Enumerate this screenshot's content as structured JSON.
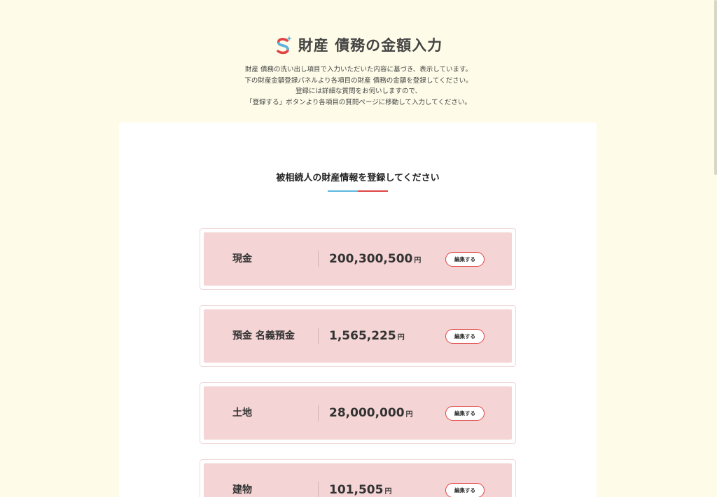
{
  "header": {
    "title": "財産 債務の金額入力",
    "logo_icon": "s-logo-icon",
    "intro_lines": [
      "財産 債務の洗い出し項目で入力いただいた内容に基づき、表示しています。",
      "下の財産金額登録パネルより各項目の財産 債務の金額を登録してください。",
      "登録には詳細な質問をお伺いしますので、",
      "「登録する」ボタンより各項目の質問ページに移動して入力してください。"
    ]
  },
  "panel": {
    "heading": "被相続人の財産情報を登録してください"
  },
  "assets": [
    {
      "name": "現金",
      "amount": "200,300,500",
      "unit": "円",
      "button": "編集する"
    },
    {
      "name": "預金 名義預金",
      "amount": "1,565,225",
      "unit": "円",
      "button": "編集する"
    },
    {
      "name": "土地",
      "amount": "28,000,000",
      "unit": "円",
      "button": "編集する"
    },
    {
      "name": "建物",
      "amount": "101,505",
      "unit": "円",
      "button": "編集する"
    }
  ],
  "colors": {
    "background": "#fefce8",
    "card_fill": "#f4d4d4",
    "accent_red": "#e04545",
    "accent_blue": "#5bb7e0"
  }
}
